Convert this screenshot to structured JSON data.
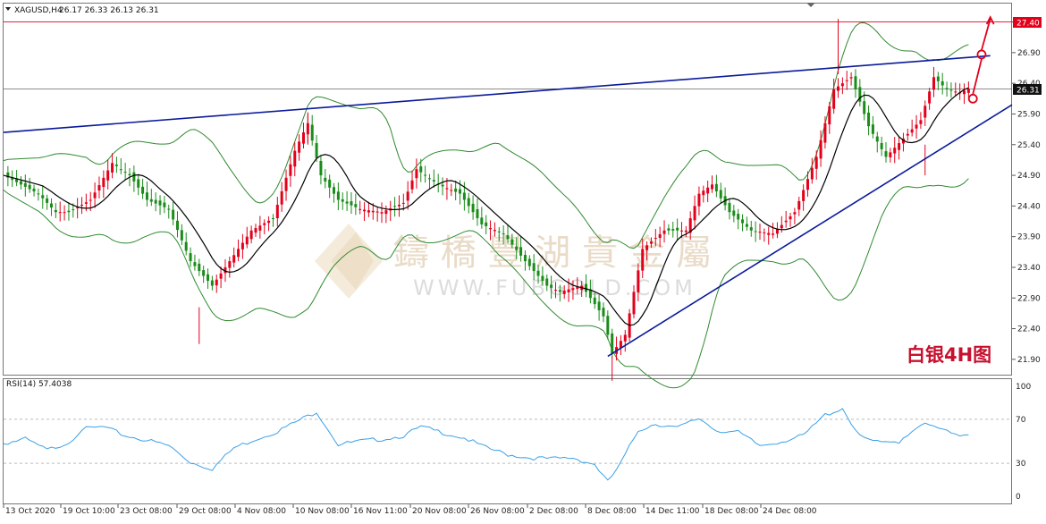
{
  "chart_data": [
    {
      "type": "candlestick",
      "symbol_header": "XAGUSD,H4",
      "ohlc_header": "26.17 26.33 26.13 26.31",
      "ylim": [
        21.65,
        27.7
      ],
      "y_ticks": [
        "27.40",
        "26.90",
        "26.40",
        "25.90",
        "25.40",
        "24.90",
        "24.40",
        "23.90",
        "23.40",
        "22.90",
        "22.40",
        "21.90"
      ],
      "resistance_level": "27.40",
      "current_price": "26.31",
      "x_ticks": [
        "13 Oct 2020",
        "19 Oct 10:00",
        "23 Oct 08:00",
        "29 Oct 08:00",
        "4 Nov 08:00",
        "10 Nov 08:00",
        "16 Nov 11:00",
        "20 Nov 08:00",
        "26 Nov 08:00",
        "2 Dec 08:00",
        "8 Dec 08:00",
        "14 Dec 11:00",
        "18 Dec 08:00",
        "24 Dec 08:00"
      ],
      "price_path": [
        [
          0,
          24.9
        ],
        [
          8,
          24.6
        ],
        [
          12,
          24.3
        ],
        [
          15,
          24.3
        ],
        [
          20,
          24.5
        ],
        [
          25,
          25.1
        ],
        [
          29,
          24.9
        ],
        [
          33,
          24.5
        ],
        [
          38,
          24.35
        ],
        [
          43,
          23.5
        ],
        [
          48,
          23.1
        ],
        [
          52,
          23.5
        ],
        [
          57,
          24.0
        ],
        [
          62,
          24.2
        ],
        [
          67,
          25.3
        ],
        [
          70,
          25.75
        ],
        [
          73,
          24.9
        ],
        [
          77,
          24.5
        ],
        [
          82,
          24.35
        ],
        [
          87,
          24.3
        ],
        [
          92,
          24.45
        ],
        [
          95,
          25.0
        ],
        [
          100,
          24.75
        ],
        [
          105,
          24.6
        ],
        [
          110,
          24.1
        ],
        [
          115,
          23.95
        ],
        [
          120,
          23.5
        ],
        [
          125,
          23.1
        ],
        [
          128,
          23.0
        ],
        [
          133,
          23.1
        ],
        [
          138,
          22.6
        ],
        [
          140,
          22.0
        ],
        [
          143,
          22.3
        ],
        [
          147,
          23.7
        ],
        [
          152,
          24.0
        ],
        [
          157,
          24.0
        ],
        [
          160,
          24.6
        ],
        [
          163,
          24.75
        ],
        [
          167,
          24.3
        ],
        [
          172,
          24.0
        ],
        [
          177,
          23.95
        ],
        [
          182,
          24.3
        ],
        [
          187,
          25.2
        ],
        [
          191,
          26.3
        ],
        [
          195,
          26.5
        ],
        [
          199,
          25.7
        ],
        [
          203,
          25.2
        ],
        [
          207,
          25.5
        ],
        [
          211,
          25.8
        ],
        [
          214,
          26.5
        ],
        [
          217,
          26.3
        ],
        [
          220,
          26.25
        ],
        [
          222,
          26.31
        ]
      ],
      "wicks": [
        [
          45,
          22.75,
          0.6
        ],
        [
          70,
          25.9,
          0.5
        ],
        [
          140,
          21.95,
          0.4
        ],
        [
          192,
          27.45,
          0.9
        ],
        [
          212,
          25.4,
          0.5
        ]
      ],
      "blue_lines": [
        {
          "from": [
            0,
            25.6
          ],
          "to": [
            227,
            26.85
          ]
        },
        {
          "from": [
            139,
            21.95
          ],
          "to": [
            232,
            26.05
          ]
        }
      ],
      "projection": {
        "start": [
          223,
          26.15
        ],
        "mid": [
          225,
          26.87
        ],
        "end": [
          227,
          27.45
        ]
      }
    },
    {
      "type": "line",
      "header": "RSI(14) 57.4038",
      "ylim": [
        0,
        100
      ],
      "y_ticks": [
        "100",
        "70",
        "30",
        "0"
      ],
      "values": [
        [
          0,
          48
        ],
        [
          5,
          52
        ],
        [
          10,
          42
        ],
        [
          15,
          49
        ],
        [
          18,
          61
        ],
        [
          23,
          63
        ],
        [
          28,
          55
        ],
        [
          33,
          51
        ],
        [
          38,
          46
        ],
        [
          43,
          31
        ],
        [
          48,
          25
        ],
        [
          53,
          44
        ],
        [
          58,
          52
        ],
        [
          63,
          59
        ],
        [
          68,
          69
        ],
        [
          72,
          77
        ],
        [
          77,
          47
        ],
        [
          82,
          50
        ],
        [
          87,
          52
        ],
        [
          92,
          55
        ],
        [
          96,
          63
        ],
        [
          101,
          58
        ],
        [
          106,
          53
        ],
        [
          111,
          44
        ],
        [
          116,
          38
        ],
        [
          121,
          35
        ],
        [
          126,
          34
        ],
        [
          131,
          35
        ],
        [
          136,
          29
        ],
        [
          139,
          13
        ],
        [
          142,
          30
        ],
        [
          146,
          60
        ],
        [
          150,
          66
        ],
        [
          155,
          62
        ],
        [
          160,
          71
        ],
        [
          164,
          60
        ],
        [
          169,
          58
        ],
        [
          174,
          46
        ],
        [
          179,
          50
        ],
        [
          184,
          55
        ],
        [
          189,
          74
        ],
        [
          193,
          80
        ],
        [
          197,
          54
        ],
        [
          202,
          48
        ],
        [
          206,
          50
        ],
        [
          211,
          66
        ],
        [
          215,
          62
        ],
        [
          219,
          55
        ],
        [
          222,
          57
        ]
      ]
    }
  ],
  "labels": {
    "chart_tag": "白银4H图",
    "watermark_cn": "鑄 橋 豐 湖 貴 金 屬",
    "watermark_en": "WWW.FUBGOLD.COM"
  },
  "colors": {
    "bull_candle": "#e3001b",
    "bear_candle": "#1a8c1a",
    "ma_line": "#000000",
    "bollinger": "#2f8a2f",
    "trendline": "#0a1a9a",
    "resistance": "#e3001b",
    "rsi": "#3aa0e8",
    "projection": "#e3001b"
  }
}
